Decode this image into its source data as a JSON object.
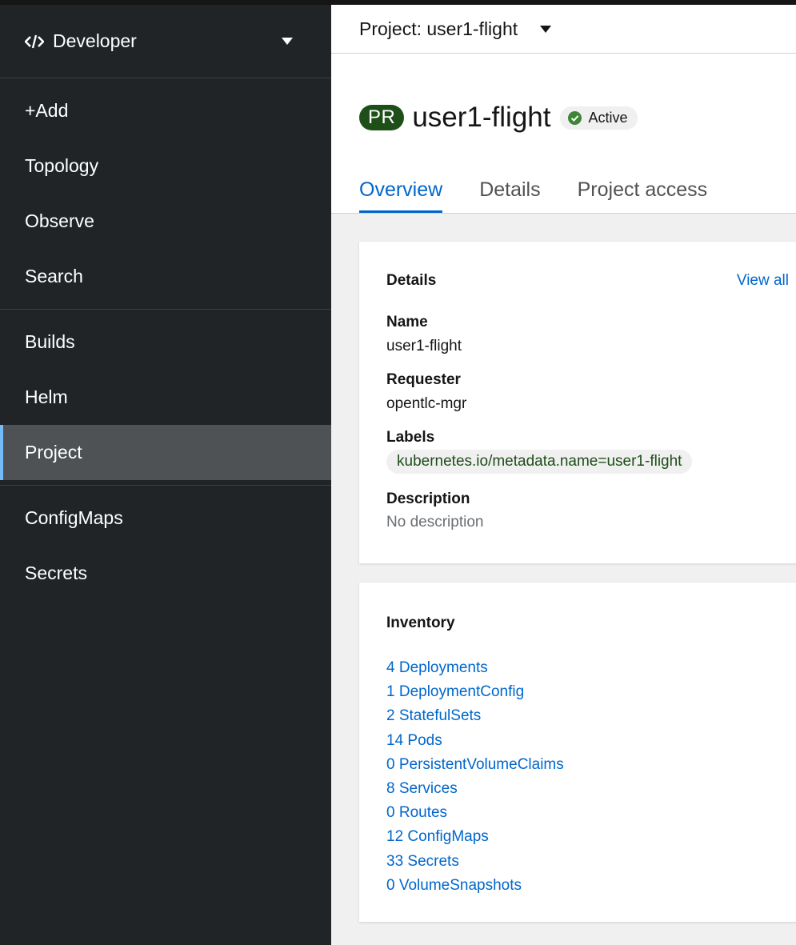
{
  "sidebar": {
    "perspective": {
      "label": "Developer",
      "icon": "code-icon"
    },
    "groups": [
      [
        {
          "label": "+Add"
        },
        {
          "label": "Topology"
        },
        {
          "label": "Observe"
        },
        {
          "label": "Search"
        }
      ],
      [
        {
          "label": "Builds"
        },
        {
          "label": "Helm"
        },
        {
          "label": "Project",
          "active": true
        }
      ],
      [
        {
          "label": "ConfigMaps"
        },
        {
          "label": "Secrets"
        }
      ]
    ]
  },
  "project_selector": {
    "label": "Project: user1-flight"
  },
  "header": {
    "badge": "PR",
    "title": "user1-flight",
    "status": "Active",
    "status_color": "#3e8635"
  },
  "tabs": [
    {
      "label": "Overview",
      "active": true
    },
    {
      "label": "Details"
    },
    {
      "label": "Project access"
    }
  ],
  "details": {
    "title": "Details",
    "view_all": "View all",
    "name_label": "Name",
    "name_value": "user1-flight",
    "requester_label": "Requester",
    "requester_value": "opentlc-mgr",
    "labels_label": "Labels",
    "label_chip": "kubernetes.io/metadata.name=user1-flight",
    "description_label": "Description",
    "description_value": "No description"
  },
  "inventory": {
    "title": "Inventory",
    "items": [
      "4 Deployments",
      "1 DeploymentConfig",
      "2 StatefulSets",
      "14 Pods",
      "0 PersistentVolumeClaims",
      "8 Services",
      "0 Routes",
      "12 ConfigMaps",
      "33 Secrets",
      "0 VolumeSnapshots"
    ]
  },
  "colors": {
    "sidebar_bg": "#212427",
    "active_nav_bg": "#4f5255",
    "link": "#0066cc",
    "badge_bg": "#1e4f18"
  }
}
